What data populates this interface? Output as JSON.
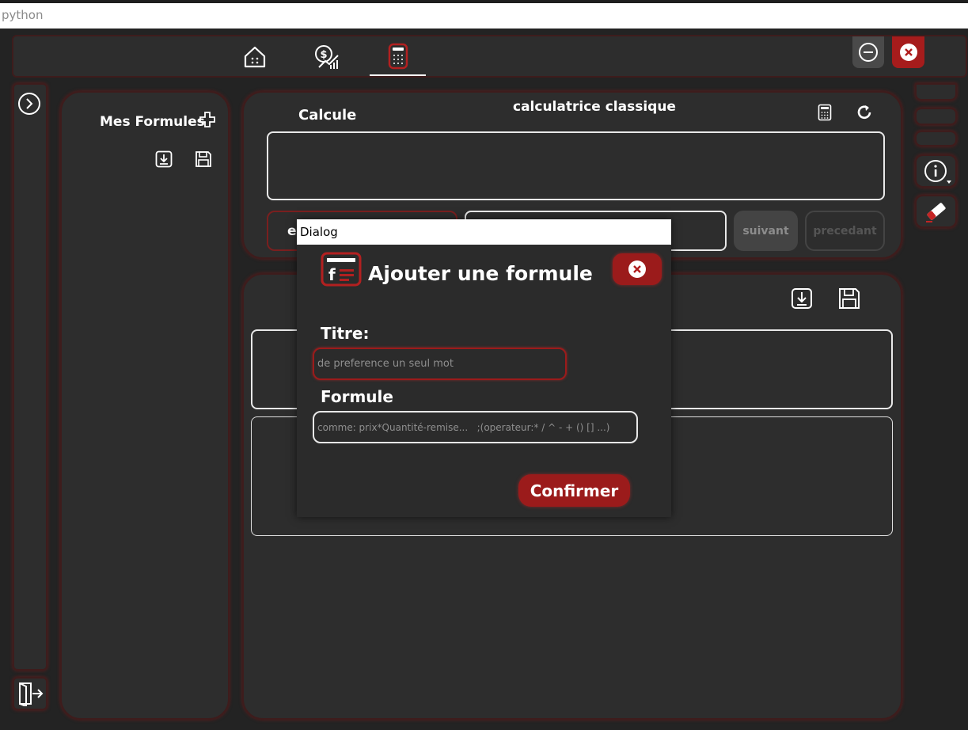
{
  "window": {
    "title": "python"
  },
  "nav": {
    "home_icon": "home-icon",
    "finance_icon": "money-chart-icon",
    "calculator_icon": "calculator-icon"
  },
  "formules_panel": {
    "title": "Mes Formules"
  },
  "calc_panel": {
    "label": "Calcule",
    "title": "calculatrice classique",
    "btn_partial": "e",
    "next_label": "suivant",
    "prev_label": "precedant"
  },
  "dialog": {
    "window_title": "Dialog",
    "heading": "Ajouter une formule",
    "titre_label": "Titre:",
    "titre_placeholder": "de preference un seul mot",
    "formule_label": "Formule",
    "formule_placeholder": "comme: prix*Quantité-remise...   ;(operateur:* / ^ - + () [] ...)",
    "confirm_label": "Confirmer"
  },
  "colors": {
    "background": "#232323",
    "panel": "#2d2d2d",
    "accent_red": "#9b1b1b",
    "glow_red": "#3e1c1c"
  }
}
